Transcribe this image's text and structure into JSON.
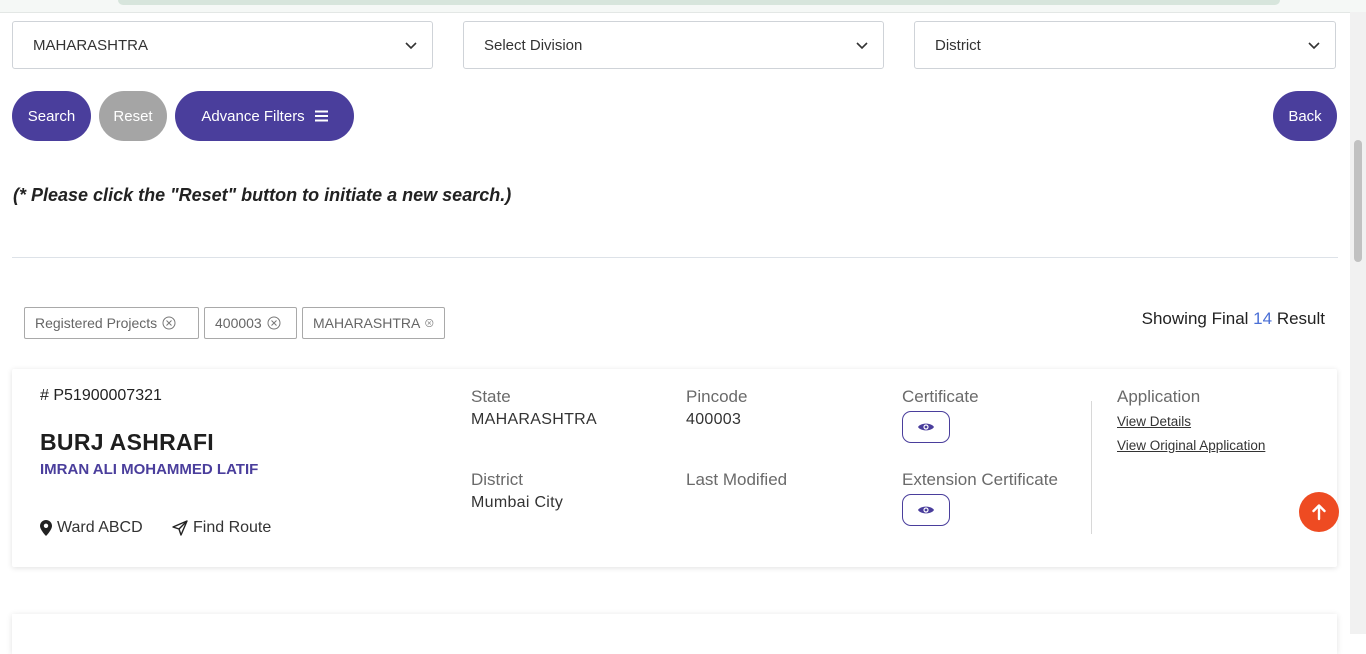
{
  "filters": {
    "state": "MAHARASHTRA",
    "division": "Select Division",
    "district": "District"
  },
  "buttons": {
    "search": "Search",
    "reset": "Reset",
    "advance": "Advance Filters",
    "back": "Back"
  },
  "note": "(* Please click the \"Reset\" button to initiate a new search.)",
  "chips": [
    "Registered Projects",
    "400003",
    "MAHARASHTRA"
  ],
  "results": {
    "prefix": "Showing Final",
    "count": "14",
    "suffix": "Result"
  },
  "project": {
    "reg_no": "# P51900007321",
    "name": "BURJ ASHRAFI",
    "promoter": "IMRAN ALI MOHAMMED LATIF",
    "ward": "Ward ABCD",
    "find_route": "Find Route",
    "state_label": "State",
    "state_value": "MAHARASHTRA",
    "pincode_label": "Pincode",
    "pincode_value": "400003",
    "certificate_label": "Certificate",
    "district_label": "District",
    "district_value": "Mumbai City",
    "last_modified_label": "Last Modified",
    "extension_label": "Extension Certificate",
    "application_label": "Application",
    "view_details": "View Details",
    "view_original": "View Original Application"
  },
  "colors": {
    "primary": "#4a3e9c",
    "reset_grey": "#a5a5a5",
    "count_blue": "#4a6fd6",
    "scroll_top": "#ee4b22"
  }
}
